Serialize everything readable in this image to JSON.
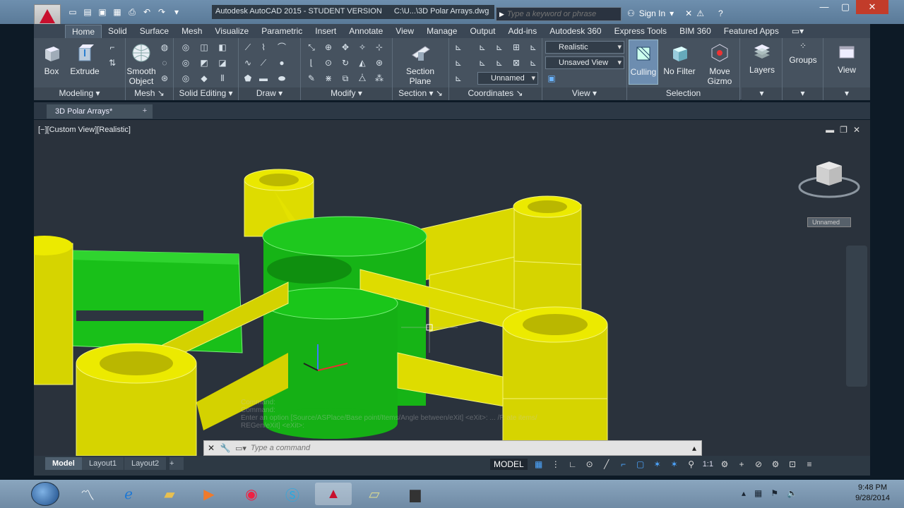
{
  "title": {
    "app": "Autodesk AutoCAD 2015 - STUDENT VERSION",
    "file": "C:\\U...\\3D Polar Arrays.dwg"
  },
  "search": {
    "placeholder": "Type a keyword or phrase"
  },
  "signin": "Sign In",
  "tabs": [
    "Home",
    "Solid",
    "Surface",
    "Mesh",
    "Visualize",
    "Parametric",
    "Insert",
    "Annotate",
    "View",
    "Manage",
    "Output",
    "Add-ins",
    "Autodesk 360",
    "Express Tools",
    "BIM 360",
    "Featured Apps"
  ],
  "ribbon": {
    "box": "Box",
    "extrude": "Extrude",
    "smooth1": "Smooth",
    "smooth2": "Object",
    "section1": "Section",
    "section2": "Plane",
    "visual_style": "Realistic",
    "saved_view": "Unsaved View",
    "ucs": "Unnamed",
    "culling": "Culling",
    "nofilter": "No Filter",
    "move1": "Move",
    "move2": "Gizmo",
    "layers": "Layers",
    "groups": "Groups",
    "view": "View",
    "panels": {
      "modeling": "Modeling",
      "mesh": "Mesh",
      "solid_editing": "Solid Editing",
      "draw": "Draw",
      "modify": "Modify",
      "section": "Section",
      "coordinates": "Coordinates",
      "view": "View",
      "selection": "Selection"
    }
  },
  "filetab": "3D Polar Arrays*",
  "viewport": {
    "label": "[−][Custom View][Realistic]",
    "ucs_name": "Unnamed"
  },
  "command": {
    "placeholder": "Type a command",
    "history": [
      "Command:",
      "Command:",
      "Enter an option [Source/ASPlace/Base point/Items/Angle between/eXit] <eXit>: ... /R  ate items/",
      "REGen/eXit] <eXit>:"
    ]
  },
  "layouts": [
    "Model",
    "Layout1",
    "Layout2"
  ],
  "status": {
    "model": "MODEL",
    "scale": "1:1"
  },
  "clock": {
    "time": "9:48 PM",
    "date": "9/28/2014"
  },
  "colors": {
    "green": "#19c019",
    "yellow": "#e8e600",
    "viewport": "#2a323c"
  }
}
